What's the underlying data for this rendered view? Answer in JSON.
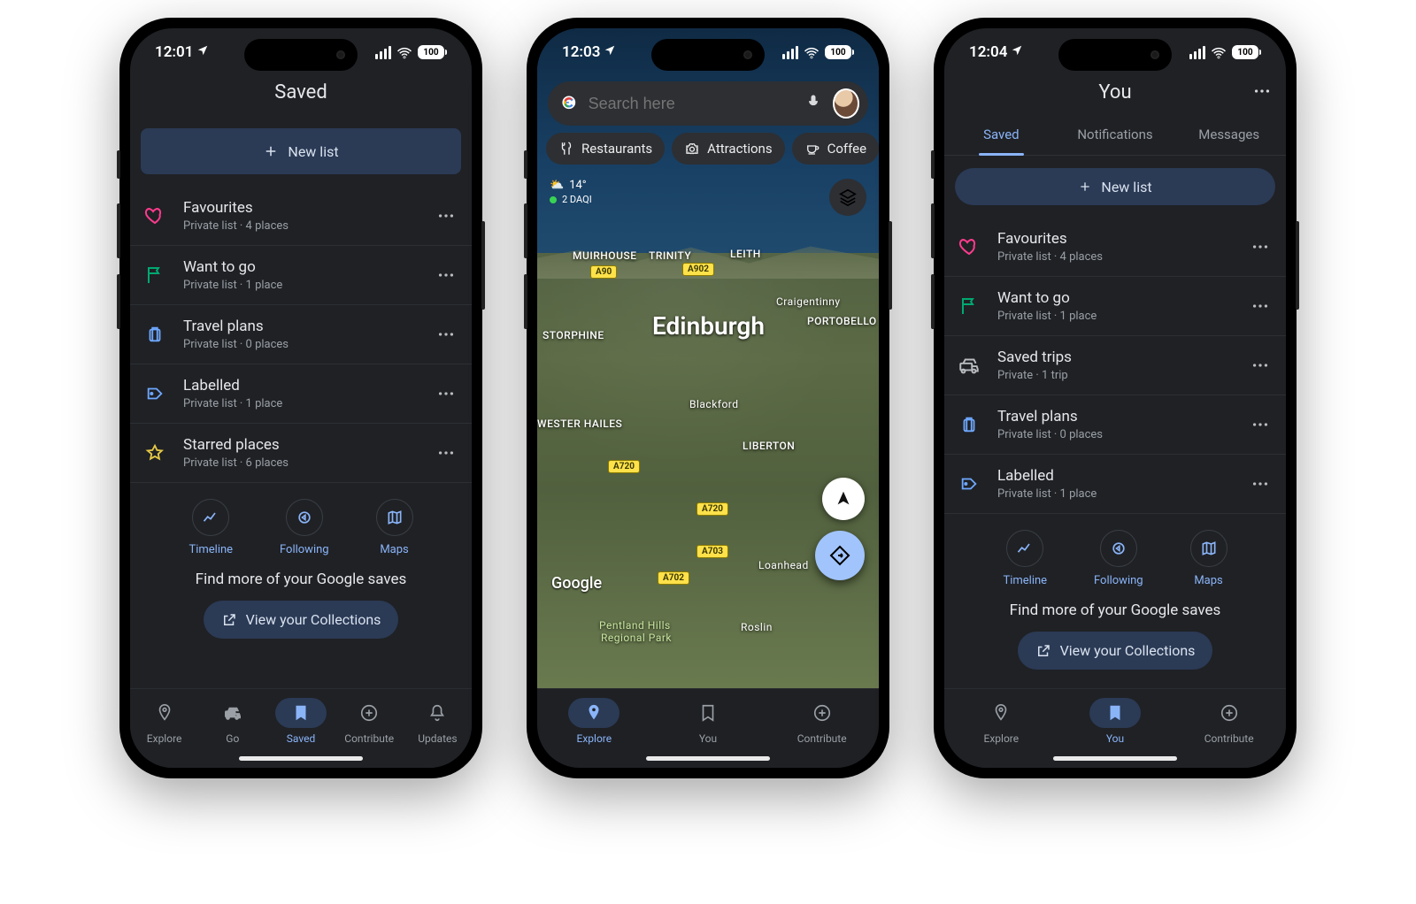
{
  "status": {
    "battery": "100"
  },
  "p1": {
    "time": "12:01",
    "title": "Saved",
    "new_list": "New list",
    "lists": [
      {
        "icon": "heart-icon",
        "title": "Favourites",
        "sub": "Private list · 4 places"
      },
      {
        "icon": "flag-icon",
        "title": "Want to go",
        "sub": "Private list · 1 place"
      },
      {
        "icon": "suitcase-icon",
        "title": "Travel plans",
        "sub": "Private list · 0 places"
      },
      {
        "icon": "label-icon",
        "title": "Labelled",
        "sub": "Private list · 1 place"
      },
      {
        "icon": "star-icon",
        "title": "Starred places",
        "sub": "Private list · 6 places"
      }
    ],
    "quick": {
      "timeline": "Timeline",
      "following": "Following",
      "maps": "Maps"
    },
    "find_more": "Find more of your Google saves",
    "collections": "View your Collections",
    "tabs": {
      "explore": "Explore",
      "go": "Go",
      "saved": "Saved",
      "contribute": "Contribute",
      "updates": "Updates",
      "active": "saved"
    }
  },
  "p2": {
    "time": "12:03",
    "search_placeholder": "Search here",
    "chips": {
      "restaurants": "Restaurants",
      "attractions": "Attractions",
      "coffee": "Coffee"
    },
    "weather": {
      "temp": "14°",
      "aqi": "2 DAQI"
    },
    "labels": {
      "edinburgh": "Edinburgh",
      "leith": "LEITH",
      "trinity": "TRINITY",
      "muirhouse": "MUIRHOUSE",
      "craigentinny": "Craigentinny",
      "portobello": "PORTOBELLO",
      "blackford": "Blackford",
      "westerhailes": "WESTER HAILES",
      "liberton": "LIBERTON",
      "loanhead": "Loanhead",
      "roslin": "Roslin",
      "pentland1": "Pentland Hills",
      "pentland2": "Regional Park",
      "storphine": "STORPHINE"
    },
    "roads": {
      "a90": "A90",
      "a902": "A902",
      "a720a": "A720",
      "a720b": "A720",
      "a703": "A703",
      "a702": "A702"
    },
    "watermark": "Google",
    "tabs": {
      "explore": "Explore",
      "you": "You",
      "contribute": "Contribute",
      "active": "explore"
    }
  },
  "p3": {
    "time": "12:04",
    "title": "You",
    "top_tabs": {
      "saved": "Saved",
      "notifications": "Notifications",
      "messages": "Messages",
      "active": "saved"
    },
    "new_list": "New list",
    "lists": [
      {
        "icon": "heart-icon",
        "title": "Favourites",
        "sub": "Private list · 4 places"
      },
      {
        "icon": "flag-icon",
        "title": "Want to go",
        "sub": "Private list · 1 place"
      },
      {
        "icon": "vehicle-icon",
        "title": "Saved trips",
        "sub": "Private · 1 trip"
      },
      {
        "icon": "suitcase-icon",
        "title": "Travel plans",
        "sub": "Private list · 0 places"
      },
      {
        "icon": "label-icon",
        "title": "Labelled",
        "sub": "Private list · 1 place"
      }
    ],
    "quick": {
      "timeline": "Timeline",
      "following": "Following",
      "maps": "Maps"
    },
    "find_more": "Find more of your Google saves",
    "collections": "View your Collections",
    "tabs": {
      "explore": "Explore",
      "you": "You",
      "contribute": "Contribute",
      "active": "you"
    }
  }
}
